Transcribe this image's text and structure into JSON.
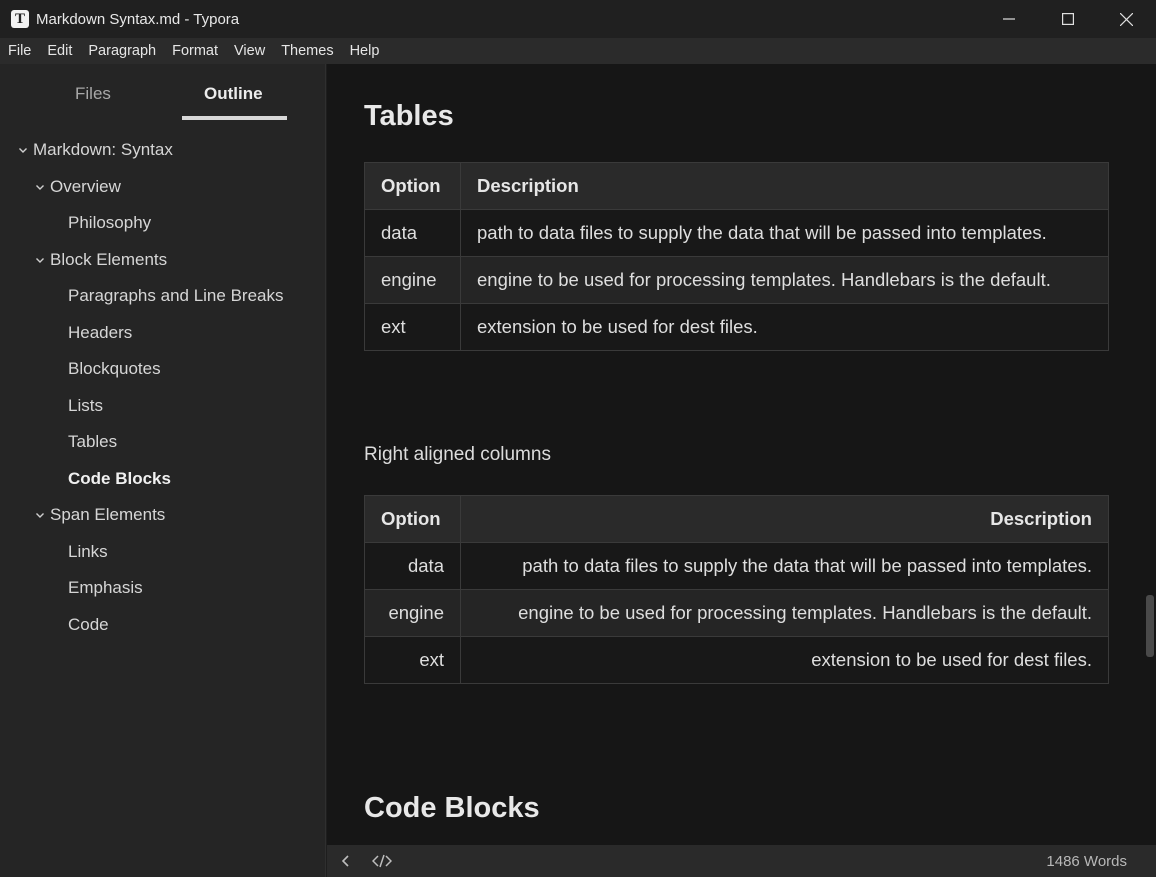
{
  "window": {
    "icon_letter": "T",
    "title": "Markdown Syntax.md - Typora"
  },
  "menu": [
    "File",
    "Edit",
    "Paragraph",
    "Format",
    "View",
    "Themes",
    "Help"
  ],
  "sidebar": {
    "tabs": {
      "files": "Files",
      "outline": "Outline",
      "active": "outline"
    },
    "outline": [
      {
        "label": "Markdown: Syntax",
        "level": 0,
        "expanded": true
      },
      {
        "label": "Overview",
        "level": 1,
        "expanded": true
      },
      {
        "label": "Philosophy",
        "level": 2
      },
      {
        "label": "Block Elements",
        "level": 1,
        "expanded": true
      },
      {
        "label": "Paragraphs and Line Breaks",
        "level": 2
      },
      {
        "label": "Headers",
        "level": 2
      },
      {
        "label": "Blockquotes",
        "level": 2
      },
      {
        "label": "Lists",
        "level": 2
      },
      {
        "label": "Tables",
        "level": 2
      },
      {
        "label": "Code Blocks",
        "level": 2,
        "active": true
      },
      {
        "label": "Span Elements",
        "level": 1,
        "expanded": true
      },
      {
        "label": "Links",
        "level": 2
      },
      {
        "label": "Emphasis",
        "level": 2
      },
      {
        "label": "Code",
        "level": 2
      }
    ]
  },
  "editor": {
    "tables_heading": "Tables",
    "table1": {
      "headers": [
        "Option",
        "Description"
      ],
      "rows": [
        [
          "data",
          "path to data files to supply the data that will be passed into templates."
        ],
        [
          "engine",
          "engine to be used for processing templates. Handlebars is the default."
        ],
        [
          "ext",
          "extension to be used for dest files."
        ]
      ]
    },
    "right_aligned_label": "Right aligned columns",
    "table2": {
      "headers": [
        "Option",
        "Description"
      ],
      "rows": [
        [
          "data",
          "path to data files to supply the data that will be passed into templates."
        ],
        [
          "engine",
          "engine to be used for processing templates. Handlebars is the default."
        ],
        [
          "ext",
          "extension to be used for dest files."
        ]
      ]
    },
    "code_blocks_heading": "Code Blocks"
  },
  "statusbar": {
    "word_count": "1486 Words",
    "icons": [
      "chevron-left-icon",
      "source-code-icon"
    ]
  }
}
